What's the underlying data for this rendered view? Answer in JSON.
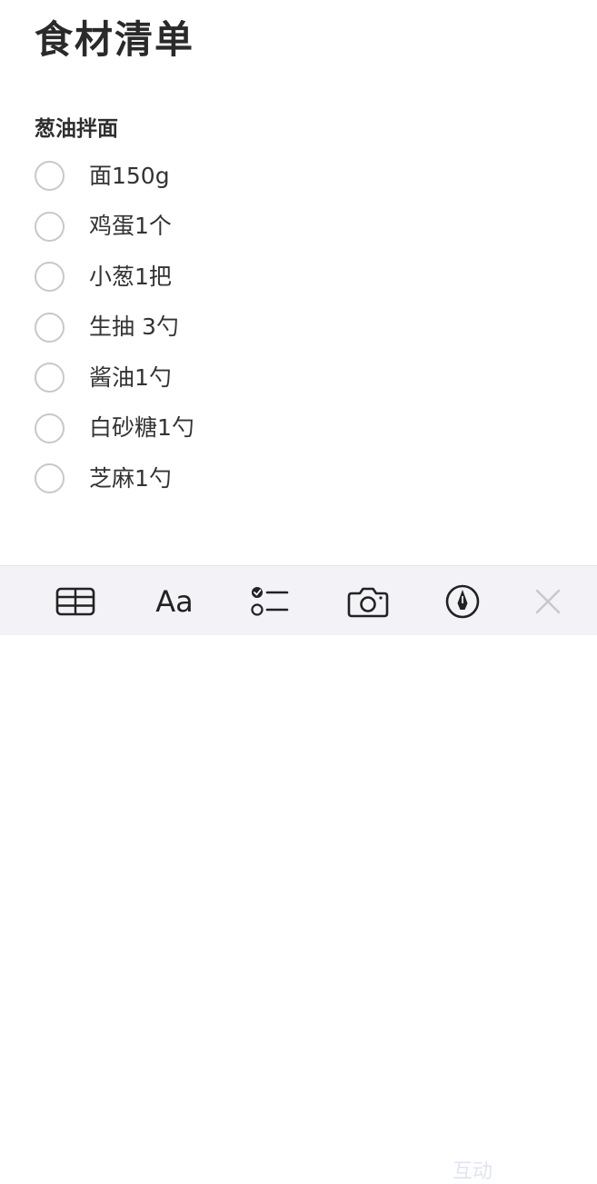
{
  "note": {
    "title": "食材清单",
    "section_heading": "葱油拌面",
    "checklist": [
      {
        "label": "面150g",
        "checked": false
      },
      {
        "label": "鸡蛋1个",
        "checked": false
      },
      {
        "label": "小葱1把",
        "checked": false
      },
      {
        "label": "生抽 3勺",
        "checked": false
      },
      {
        "label": "酱油1勺",
        "checked": false
      },
      {
        "label": "白砂糖1勺",
        "checked": false
      },
      {
        "label": "芝麻1勺",
        "checked": false
      }
    ]
  },
  "toolbar": {
    "table_icon": "table-icon",
    "format_label": "Aa",
    "checklist_icon": "checklist-icon",
    "camera_icon": "camera-icon",
    "markup_icon": "markup-pen-icon",
    "close_icon": "close-icon"
  },
  "watermark": {
    "text": "互动"
  },
  "colors": {
    "toolbar_background": "#f2f2f7",
    "circle_border": "#c7c7cc",
    "text": "#333333",
    "icon": "#222222"
  }
}
